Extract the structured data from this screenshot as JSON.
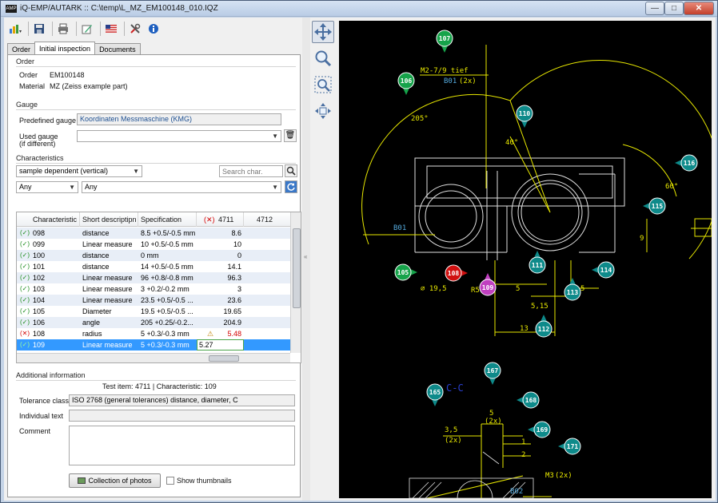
{
  "window": {
    "logo_text": "AMP",
    "title": "iQ-EMP/AUTARK :: C:\\temp\\L_MZ_EM100148_010.IQZ",
    "minimize": "—",
    "maximize": "□",
    "close": "✕"
  },
  "toolbar": {
    "icons": [
      "chart-icon",
      "save-icon",
      "print-icon",
      "edit-icon",
      "flag-us-icon",
      "tools-icon",
      "info-icon"
    ]
  },
  "tabs": [
    {
      "label": "Order"
    },
    {
      "label": "Initial inspection"
    },
    {
      "label": "Documents"
    }
  ],
  "order": {
    "section_title": "Order",
    "order_label": "Order",
    "order_value": "EM100148",
    "material_label": "Material",
    "material_value": "MZ (Zeiss example part)"
  },
  "gauge": {
    "section_title": "Gauge",
    "predefined_label": "Predefined gauge",
    "predefined_value": "Koordinaten Messmaschine (KMG)",
    "used_label": "Used gauge",
    "used_label2": "(if different)",
    "used_value": ""
  },
  "characteristics": {
    "section_title": "Characteristics",
    "mode_select": "sample dependent (vertical)",
    "search_placeholder": "Search char.",
    "filter1": "Any",
    "filter2": "Any",
    "columns": [
      "Characteristic",
      "Short descriptipn",
      "Specification",
      "4711",
      "4712"
    ],
    "rows": [
      {
        "status": "ok",
        "char": "098",
        "desc": "distance",
        "spec": "8.5 +0.5/-0.5 mm",
        "v4711": "8.6"
      },
      {
        "status": "ok",
        "char": "099",
        "desc": "Linear measure",
        "spec": "10 +0.5/-0.5 mm",
        "v4711": "10"
      },
      {
        "status": "ok",
        "char": "100",
        "desc": "distance",
        "spec": "0 mm",
        "v4711": "0"
      },
      {
        "status": "ok",
        "char": "101",
        "desc": "distance",
        "spec": "14 +0.5/-0.5 mm",
        "v4711": "14.1"
      },
      {
        "status": "ok",
        "char": "102",
        "desc": "Linear measure",
        "spec": "96 +0.8/-0.8 mm",
        "v4711": "96.3"
      },
      {
        "status": "ok",
        "char": "103",
        "desc": "Linear measure",
        "spec": "3 +0.2/-0.2 mm",
        "v4711": "3"
      },
      {
        "status": "ok",
        "char": "104",
        "desc": "Linear measure",
        "spec": "23.5 +0.5/-0.5 ...",
        "v4711": "23.6"
      },
      {
        "status": "ok",
        "char": "105",
        "desc": "Diameter",
        "spec": "19.5 +0.5/-0.5 ...",
        "v4711": "19.65"
      },
      {
        "status": "ok",
        "char": "106",
        "desc": "angle",
        "spec": "205 +0.25/-0.2...",
        "v4711": "204.9"
      },
      {
        "status": "nok",
        "char": "108",
        "desc": "radius",
        "spec": "5 +0.3/-0.3 mm",
        "v4711": "5.48"
      },
      {
        "status": "ok",
        "char": "109",
        "desc": "Linear measure",
        "spec": "5 +0.3/-0.3 mm",
        "v4711": "5.27"
      }
    ]
  },
  "additional": {
    "section_title": "Additional information",
    "test_item_line": "Test item: 4711 | Characteristic: 109",
    "tolerance_label": "Tolerance class",
    "tolerance_value": "ISO 2768 (general tolerances) distance, diameter, C",
    "individual_label": "Individual text",
    "individual_value": "",
    "comment_label": "Comment",
    "comment_value": "",
    "photos_button": "Collection of photos",
    "thumbnails_label": "Show thumbnails"
  },
  "drawing": {
    "balloons": [
      "107",
      "106",
      "110",
      "116",
      "115",
      "105",
      "108",
      "111",
      "109",
      "113",
      "114",
      "112",
      "167",
      "165",
      "168",
      "169",
      "171"
    ],
    "labels": {
      "thread": "M2-7/9 tief",
      "b01_top": "B01",
      "b01_top2": "(2x)",
      "angle205": "205°",
      "angle40": "40°",
      "angle60": "60°",
      "b01_left": "B01",
      "dim_9": "9",
      "dia195": "⌀ 19,5",
      "r5": "R5",
      "dim5a": "5",
      "dim5b": "5",
      "dim515": "5,15",
      "dim13": "13",
      "section": "C-C",
      "dim5c": "5",
      "dim2x": "(2x)",
      "dim35": "3,5",
      "dim2x_b": "(2x)",
      "dim1": "1",
      "dim2": "2",
      "m3": "M3",
      "m3_2x": "(2x)",
      "b02": "B02"
    }
  }
}
